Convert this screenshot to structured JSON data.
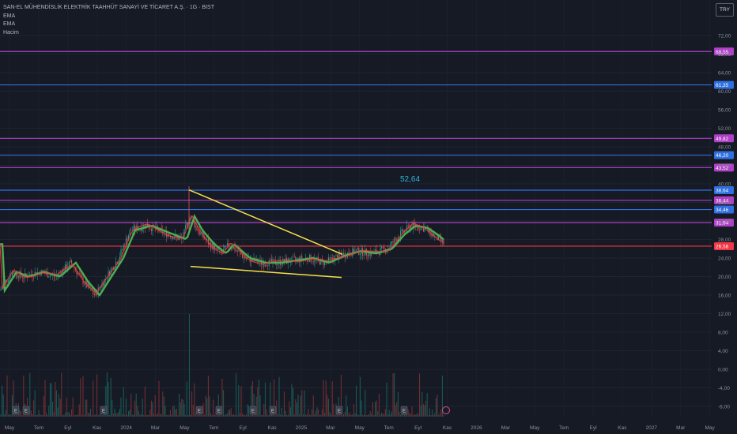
{
  "header": {
    "title": "SAN-EL MÜHENDİSLİK ELEKTRİK TAAHHÜT SANAYİ VE TİCARET A.Ş. · 1G · BIST",
    "indicators": [
      "EMA",
      "EMA",
      "Hacim"
    ],
    "currency": "TRY"
  },
  "chart_data": {
    "type": "candlestick",
    "y_ticks": [
      "72,00",
      "68,00",
      "64,00",
      "60,00",
      "56,00",
      "52,00",
      "48,00",
      "44,00",
      "40,00",
      "36,00",
      "32,00",
      "28,00",
      "24,00",
      "20,00",
      "16,00",
      "12,00",
      "8,00",
      "4,00",
      "0,00",
      "-4,00",
      "-8,00"
    ],
    "x_ticks": [
      "May",
      "Tem",
      "Eyl",
      "Kas",
      "2024",
      "Mar",
      "May",
      "Tem",
      "Eyl",
      "Kas",
      "2025",
      "Mar",
      "May",
      "Tem",
      "Eyl",
      "Kas",
      "2026",
      "Mar",
      "May",
      "Tem",
      "Eyl",
      "Kas",
      "2027",
      "Mar",
      "May"
    ],
    "levels": [
      {
        "value": "68,55",
        "color": "#b03fc7"
      },
      {
        "value": "61,35",
        "color": "#2f6fe0"
      },
      {
        "value": "49,82",
        "color": "#b03fc7"
      },
      {
        "value": "46,20",
        "color": "#2f6fe0"
      },
      {
        "value": "43,52",
        "color": "#b03fc7"
      },
      {
        "value": "38,64",
        "color": "#2f6fe0"
      },
      {
        "value": "36,44",
        "color": "#b03fc7"
      },
      {
        "value": "34,46",
        "color": "#2f6fe0"
      },
      {
        "value": "31,64",
        "color": "#b03fc7"
      }
    ],
    "last_price": {
      "value": "26,56",
      "color": "#f23645"
    },
    "annotation": "52,64",
    "trendlines_color": "#f5e04a",
    "ema_fast_color": "#f23645",
    "ema_slow_color": "#4caf50",
    "event_markers": [
      "E",
      "E",
      "E",
      "E",
      "E",
      "E",
      "E",
      "E",
      "E",
      "E"
    ]
  }
}
